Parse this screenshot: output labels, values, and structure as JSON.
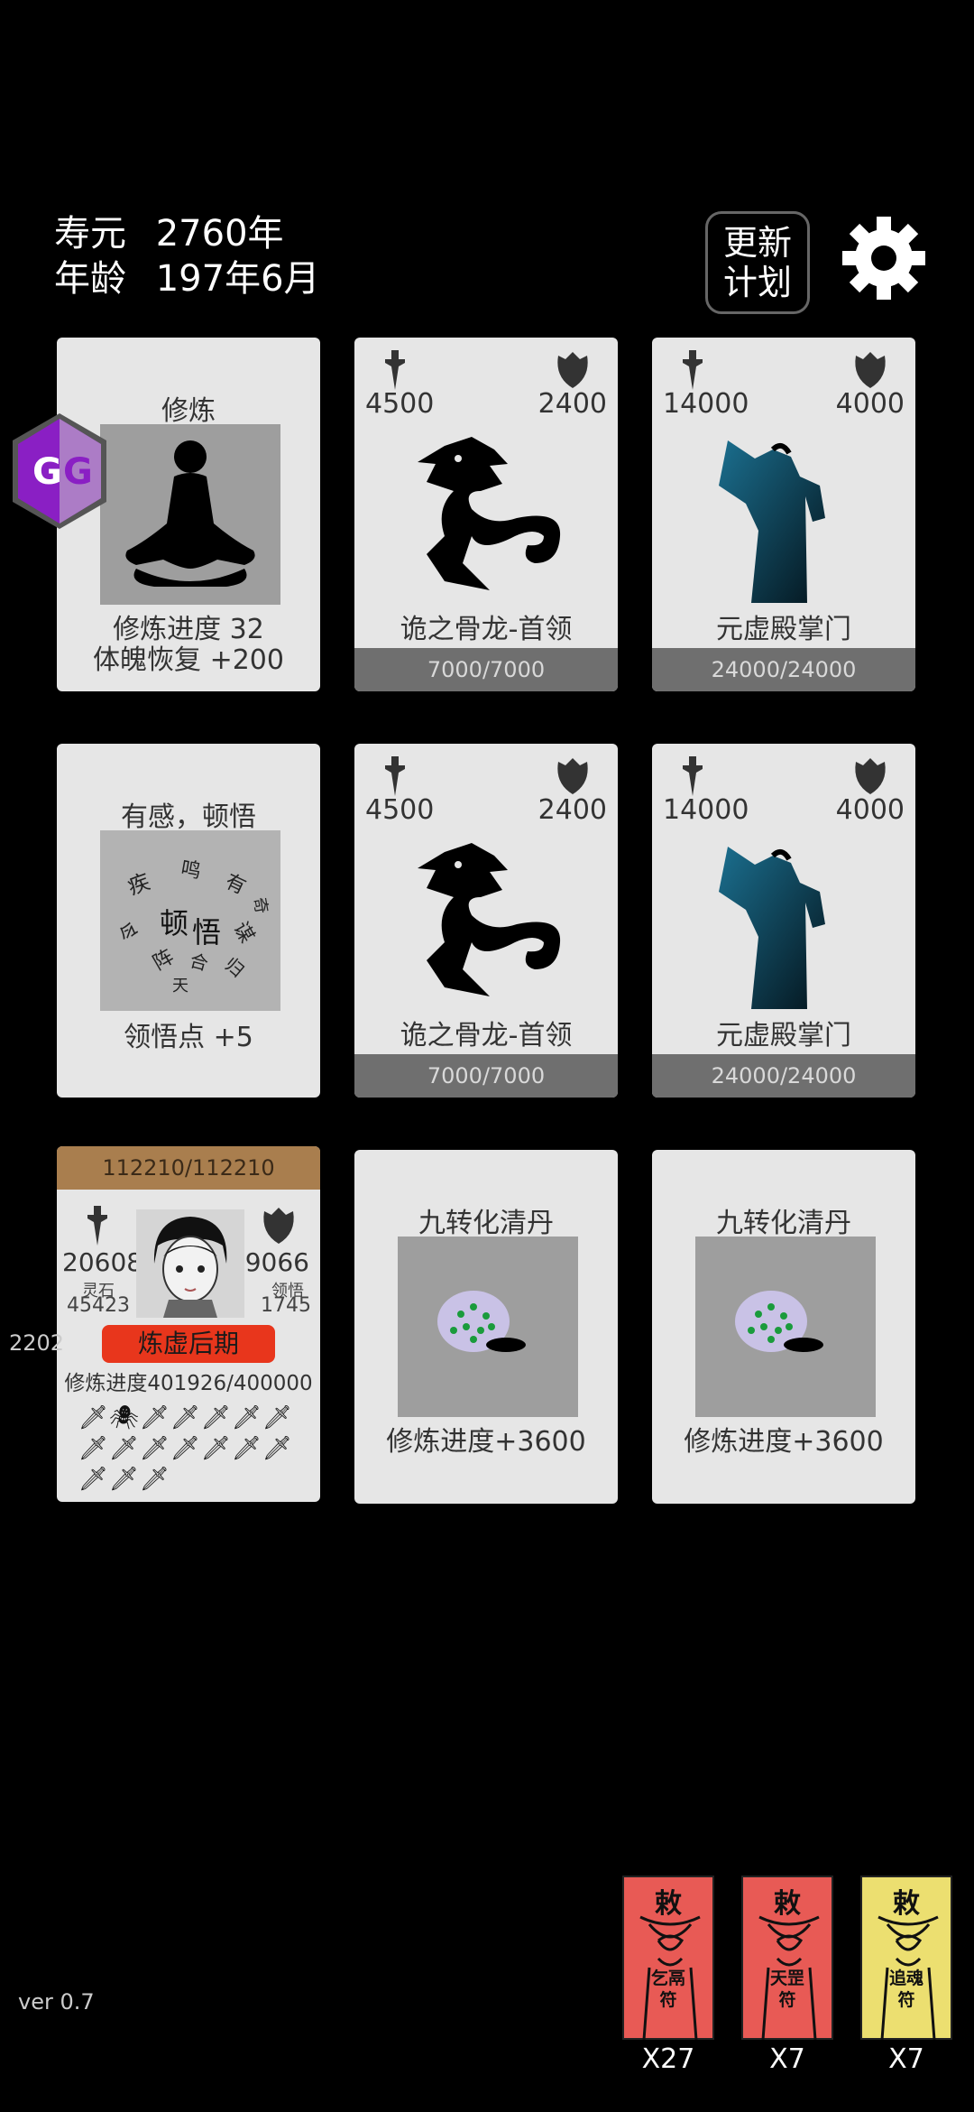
{
  "status": {
    "lifespan_label": "寿元",
    "lifespan_value": "2760年",
    "age_label": "年龄",
    "age_value": "197年6月"
  },
  "header": {
    "update_plan_line1": "更新",
    "update_plan_line2": "计划"
  },
  "cards": [
    {
      "type": "action",
      "title": "修炼",
      "line1": "修炼进度  32",
      "line2": "体魄恢复  +200"
    },
    {
      "type": "enemy",
      "attack": "4500",
      "defense": "2400",
      "name": "诡之骨龙-首领",
      "hp": "7000/7000"
    },
    {
      "type": "enemy",
      "attack": "14000",
      "defense": "4000",
      "name": "元虚殿掌门",
      "hp": "24000/24000"
    },
    {
      "type": "action",
      "title": "有感，顿悟",
      "line1": "领悟点  +5"
    },
    {
      "type": "enemy",
      "attack": "4500",
      "defense": "2400",
      "name": "诡之骨龙-首领",
      "hp": "7000/7000"
    },
    {
      "type": "enemy",
      "attack": "14000",
      "defense": "4000",
      "name": "元虚殿掌门",
      "hp": "24000/24000"
    },
    {
      "type": "item",
      "title": "九转化清丹",
      "line1": "修炼进度+3600"
    },
    {
      "type": "item",
      "title": "九转化清丹",
      "line1": "修炼进度+3600"
    }
  ],
  "insight_words": [
    "疾",
    "鸣",
    "有",
    "顿",
    "悟",
    "令",
    "谋",
    "阵",
    "合",
    "归",
    "天",
    "奇"
  ],
  "player": {
    "hp": "112210/112210",
    "attack": "20608",
    "defense": "9066",
    "spirit_stone_label": "灵石",
    "spirit_stone": "45423",
    "insight_label": "领悟",
    "insight": "1745",
    "realm": "炼虚后期",
    "progress_label": "修炼进度",
    "progress_value": "401926/400000",
    "side_number": "2202",
    "skills": [
      "🗡",
      "🕷",
      "🗡",
      "🗡",
      "🗡",
      "🗡",
      "🗡",
      "🗡",
      "🗡",
      "🗡",
      "🗡",
      "🗡",
      "🗡",
      "🗡",
      "🗡",
      "🗡",
      "🗡"
    ]
  },
  "talismans": [
    {
      "line1": "乞鬲",
      "line2": "符",
      "count": "X27",
      "color": "#e85a55"
    },
    {
      "line1": "天罡",
      "line2": "符",
      "count": "X7",
      "color": "#e85a55"
    },
    {
      "line1": "追魂",
      "line2": "符",
      "count": "X7",
      "color": "#ecdf70"
    }
  ],
  "talisman_header": "敕",
  "version": "ver 0.7"
}
